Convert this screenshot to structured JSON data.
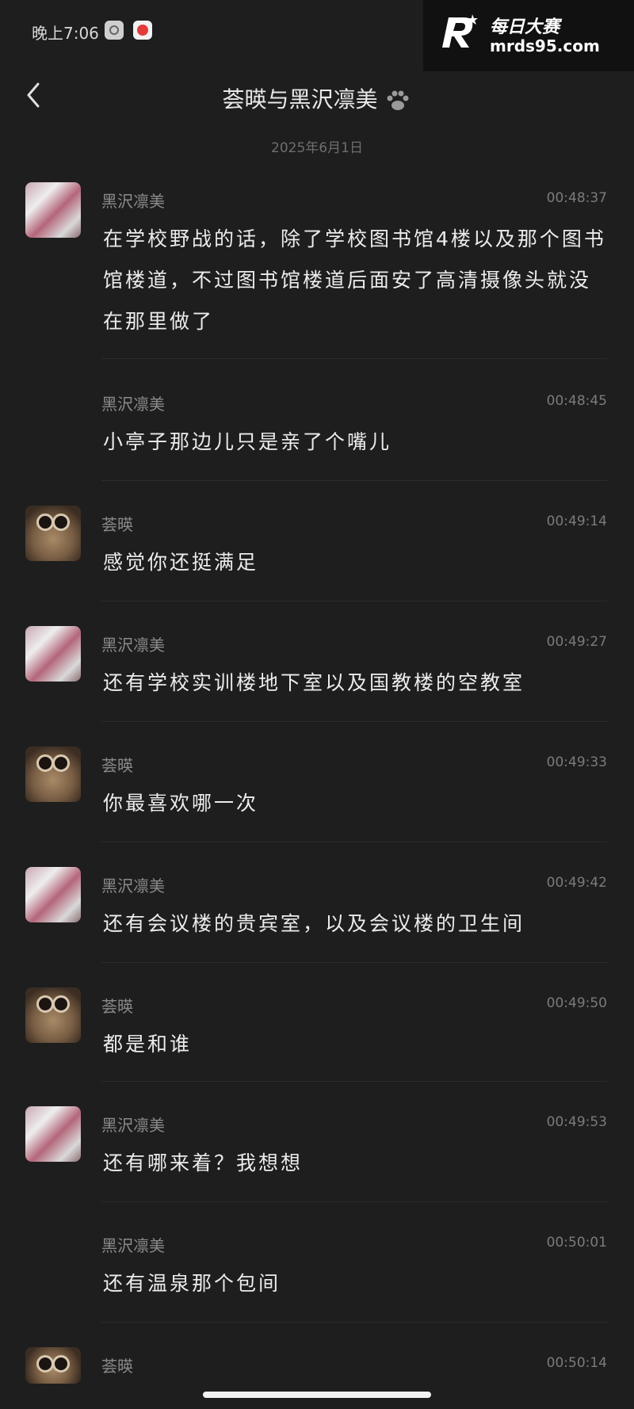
{
  "status": {
    "time": "晚上7:06"
  },
  "watermark": {
    "brand": "每日大赛",
    "url": "mrds95.com"
  },
  "header": {
    "title": "荟暎与黑沢凛美"
  },
  "date_separator": "2025年6月1日",
  "messages": [
    {
      "sender": "黑沢凛美",
      "time": "00:48:37",
      "text": "在学校野战的话，除了学校图书馆4楼以及那个图书馆楼道，不过图书馆楼道后面安了高清摄像头就没在那里做了"
    },
    {
      "sender": "黑沢凛美",
      "time": "00:48:45",
      "text": "小亭子那边儿只是亲了个嘴儿"
    },
    {
      "sender": "荟暎",
      "time": "00:49:14",
      "text": "感觉你还挺满足"
    },
    {
      "sender": "黑沢凛美",
      "time": "00:49:27",
      "text": "还有学校实训楼地下室以及国教楼的空教室"
    },
    {
      "sender": "荟暎",
      "time": "00:49:33",
      "text": "你最喜欢哪一次"
    },
    {
      "sender": "黑沢凛美",
      "time": "00:49:42",
      "text": "还有会议楼的贵宾室，以及会议楼的卫生间"
    },
    {
      "sender": "荟暎",
      "time": "00:49:50",
      "text": "都是和谁"
    },
    {
      "sender": "黑沢凛美",
      "time": "00:49:53",
      "text": "还有哪来着？我想想"
    },
    {
      "sender": "黑沢凛美",
      "time": "00:50:01",
      "text": "还有温泉那个包间"
    },
    {
      "sender": "荟暎",
      "time": "00:50:14",
      "text": ""
    }
  ]
}
